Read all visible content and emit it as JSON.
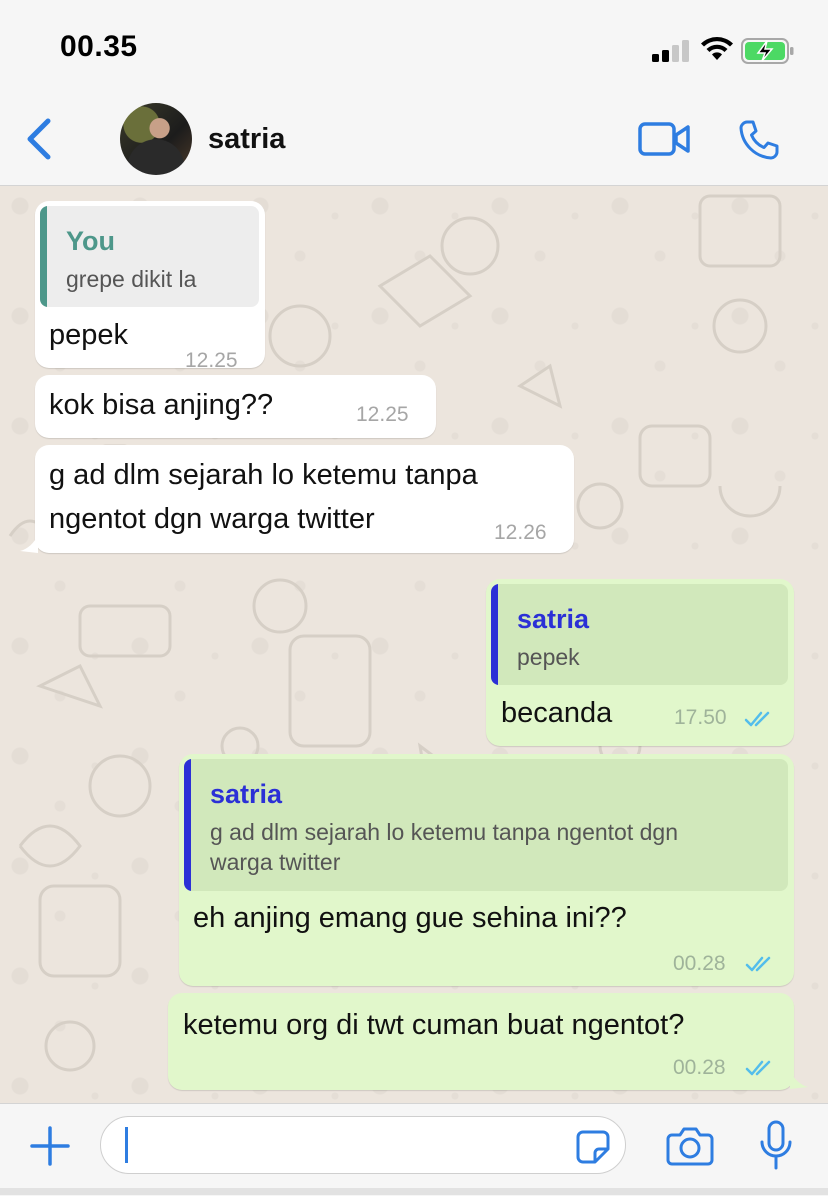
{
  "status": {
    "time": "00.35"
  },
  "header": {
    "contact_name": "satria"
  },
  "messages": [
    {
      "quote_author": "You",
      "quote_text": "grepe dikit la",
      "text": "pepek",
      "time": "12.25"
    },
    {
      "text": "kok bisa anjing??",
      "time": "12.25"
    },
    {
      "text_line1": "g ad dlm sejarah lo ketemu tanpa",
      "text_line2": "ngentot dgn warga twitter",
      "time": "12.26"
    },
    {
      "quote_author": "satria",
      "quote_text": "pepek",
      "text": "becanda",
      "time": "17.50"
    },
    {
      "quote_author": "satria",
      "quote_text_line1": "g ad dlm sejarah lo ketemu tanpa ngentot dgn",
      "quote_text_line2": "warga twitter",
      "text": "eh anjing emang gue sehina ini??",
      "time": "00.28"
    },
    {
      "text": "ketemu org di twt cuman buat ngentot?",
      "time": "00.28"
    }
  ],
  "input": {
    "value": ""
  },
  "colors": {
    "accent": "#2e7de1",
    "incoming_bubble": "#ffffff",
    "outgoing_bubble": "#e1f7cb",
    "quote_you": "#4d978a",
    "quote_contact": "#2b30d6",
    "read_ticks": "#53bdeb"
  },
  "icons": [
    "signal-icon",
    "wifi-icon",
    "battery-charging-icon",
    "back-chevron-icon",
    "video-call-icon",
    "phone-icon",
    "plus-icon",
    "sticker-icon",
    "camera-icon",
    "microphone-icon",
    "read-receipt-icon"
  ]
}
